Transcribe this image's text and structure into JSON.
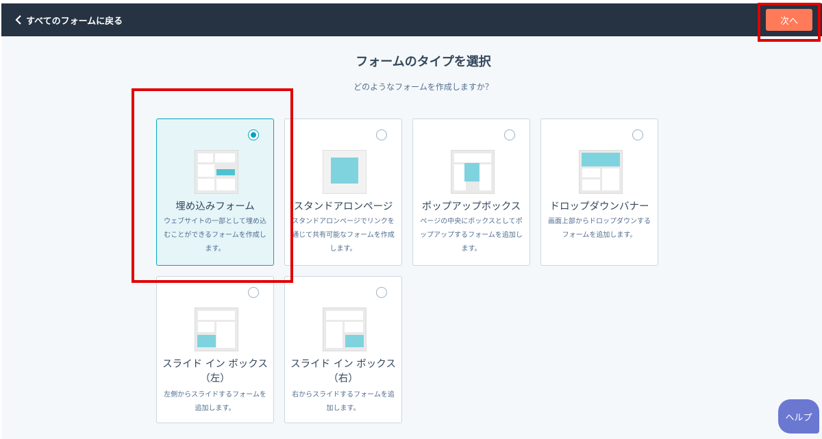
{
  "header": {
    "back_label": "すべてのフォームに戻る",
    "next_label": "次へ"
  },
  "page": {
    "title": "フォームのタイプを選択",
    "subtitle": "どのようなフォームを作成しますか？"
  },
  "cards": [
    {
      "title": "埋め込みフォーム",
      "desc": "ウェブサイトの一部として埋め込むことができるフォームを作成します。",
      "selected": true
    },
    {
      "title": "スタンドアロンページ",
      "desc": "スタンドアロンページでリンクを通じて共有可能なフォームを作成します。",
      "selected": false
    },
    {
      "title": "ポップアップボックス",
      "desc": "ページの中央にボックスとしてポップアップするフォームを追加します。",
      "selected": false
    },
    {
      "title": "ドロップダウンバナー",
      "desc": "画面上部からドロップダウンするフォームを追加します。",
      "selected": false
    },
    {
      "title": "スライド イン ボックス（左）",
      "desc": "左側からスライドするフォームを追加します。",
      "selected": false
    },
    {
      "title": "スライド イン ボックス（右）",
      "desc": "右からスライドするフォームを追加します。",
      "selected": false
    }
  ],
  "help": {
    "label": "ヘルプ"
  },
  "colors": {
    "header_bg": "#253342",
    "accent": "#ff7a59",
    "selected": "#00a4bd",
    "thumb_fill": "#7fd3df",
    "help": "#6a78d1",
    "highlight": "#e00000"
  }
}
